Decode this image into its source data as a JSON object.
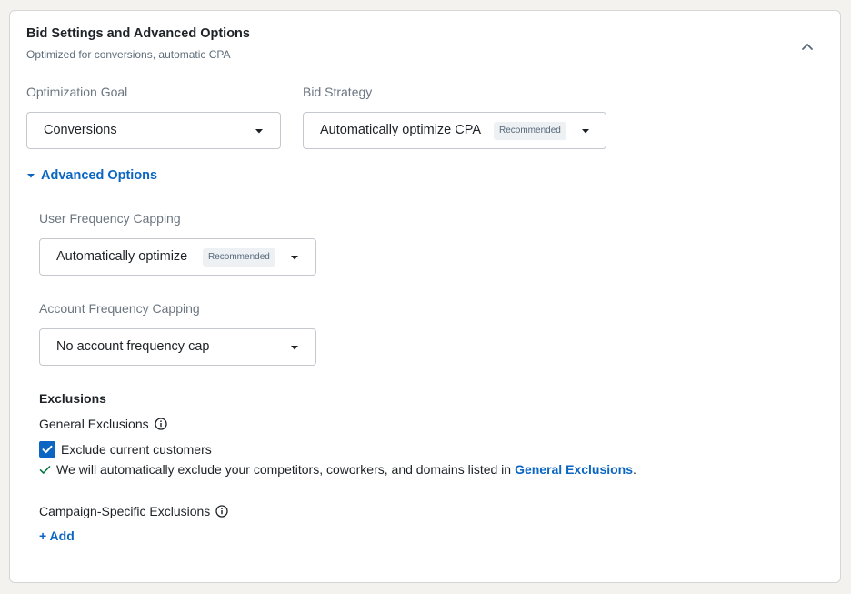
{
  "panel": {
    "title": "Bid Settings and Advanced Options",
    "subtitle": "Optimized for conversions, automatic CPA"
  },
  "optimization_goal": {
    "label": "Optimization Goal",
    "value": "Conversions"
  },
  "bid_strategy": {
    "label": "Bid Strategy",
    "value": "Automatically optimize CPA",
    "badge": "Recommended"
  },
  "advanced": {
    "toggle_label": "Advanced Options",
    "user_freq": {
      "label": "User Frequency Capping",
      "value": "Automatically optimize",
      "badge": "Recommended"
    },
    "account_freq": {
      "label": "Account Frequency Capping",
      "value": "No account frequency cap"
    }
  },
  "exclusions": {
    "heading": "Exclusions",
    "general_label": "General Exclusions",
    "checkbox_label": "Exclude current customers",
    "checkbox_checked": true,
    "note_text": "We will automatically exclude your competitors, coworkers, and domains listed in",
    "note_link": "General Exclusions",
    "note_end": ".",
    "campaign_label": "Campaign-Specific Exclusions",
    "add_label": "+ Add"
  },
  "icons": [
    "chevron-up-icon",
    "caret-down-icon",
    "info-icon",
    "check-icon",
    "checkmark-icon"
  ],
  "colors": {
    "accent": "#0a66c2",
    "success": "#057642",
    "text": "#1d2226",
    "muted": "#6b7680"
  }
}
